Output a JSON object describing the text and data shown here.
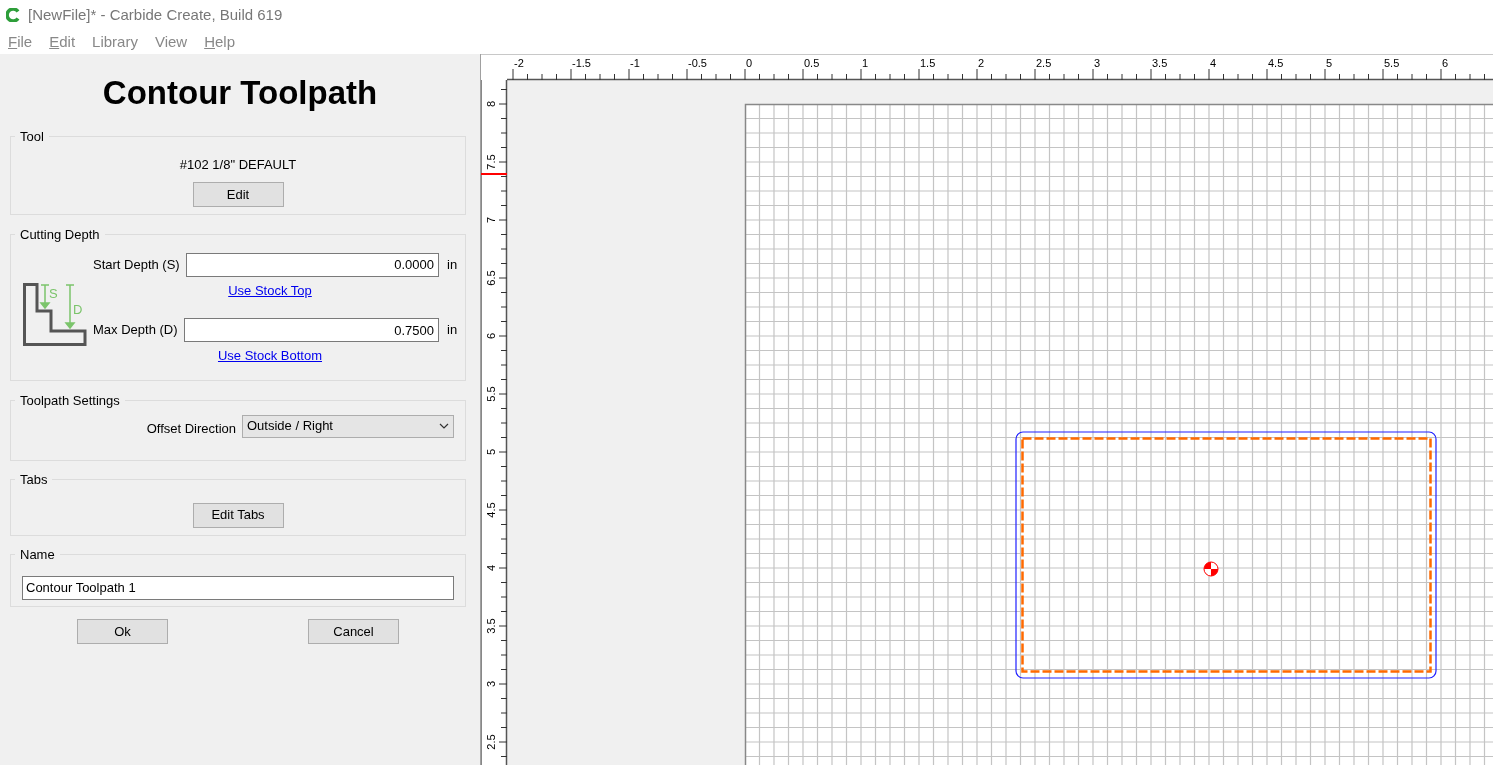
{
  "window": {
    "title": "[NewFile]* - Carbide Create, Build 619"
  },
  "menu": [
    {
      "label": "File",
      "mnemonic": true
    },
    {
      "label": "Edit",
      "mnemonic": true
    },
    {
      "label": "Library",
      "mnemonic": false
    },
    {
      "label": "View",
      "mnemonic": false
    },
    {
      "label": "Help",
      "mnemonic": true
    }
  ],
  "panel": {
    "title": "Contour Toolpath",
    "tool": {
      "heading": "Tool",
      "name": "#102 1/8\" DEFAULT",
      "button": "Edit"
    },
    "cutting_depth": {
      "heading": "Cutting Depth",
      "diagram_labels": [
        "S",
        "D"
      ],
      "fields": [
        {
          "label": "Start Depth (S)",
          "value": "0.0000",
          "unit": "in",
          "link": "Use Stock Top"
        },
        {
          "label": "Max Depth (D)",
          "value": "0.7500",
          "unit": "in",
          "link": "Use Stock Bottom"
        }
      ]
    },
    "toolpath_settings": {
      "heading": "Toolpath Settings",
      "label": "Offset Direction",
      "value": "Outside / Right"
    },
    "tabs": {
      "heading": "Tabs",
      "button": "Edit Tabs"
    },
    "name": {
      "heading": "Name",
      "value": "Contour Toolpath 1"
    },
    "buttons": [
      "Ok",
      "Cancel"
    ]
  },
  "canvas": {
    "x_ruler": [
      "-2",
      "-1.5",
      "-1",
      "-0.5",
      "0",
      "0.5",
      "1",
      "1.5",
      "2",
      "2.5",
      "3",
      "3.5",
      "4",
      "4.5",
      "5",
      "5.5",
      "6"
    ],
    "y_ruler": [
      "8",
      "7.5",
      "7",
      "6.5",
      "6",
      "5.5",
      "5",
      "4.5",
      "4",
      "3.5",
      "3",
      "2.5"
    ]
  }
}
